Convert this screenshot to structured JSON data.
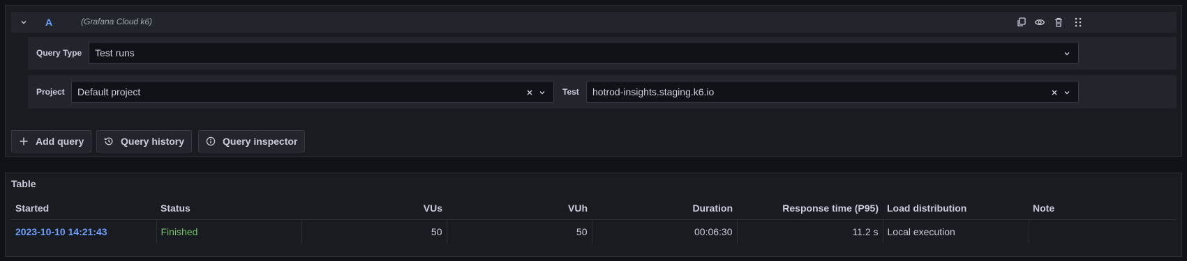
{
  "query": {
    "ref_id": "A",
    "datasource": "(Grafana Cloud k6)",
    "query_type_label": "Query Type",
    "query_type_value": "Test runs",
    "project_label": "Project",
    "project_value": "Default project",
    "test_label": "Test",
    "test_value": "hotrod-insights.staging.k6.io"
  },
  "header_icons": [
    "duplicate-icon",
    "eye-icon",
    "trash-icon",
    "drag-handle-icon"
  ],
  "buttons": {
    "add_query": "Add query",
    "query_history": "Query history",
    "query_inspector": "Query inspector"
  },
  "table": {
    "title": "Table",
    "columns": [
      "Started",
      "Status",
      "VUs",
      "VUh",
      "Duration",
      "Response time (P95)",
      "Load distribution",
      "Note"
    ],
    "rows": [
      [
        "2023-10-10 14:21:43",
        "Finished",
        "50",
        "50",
        "00:06:30",
        "11.2 s",
        "Local execution",
        ""
      ]
    ]
  },
  "colors": {
    "background": "#111217",
    "panel": "#181b1f",
    "accent_blue": "#6e9fff",
    "status_green": "#73bf69",
    "text": "#ccccdc"
  }
}
